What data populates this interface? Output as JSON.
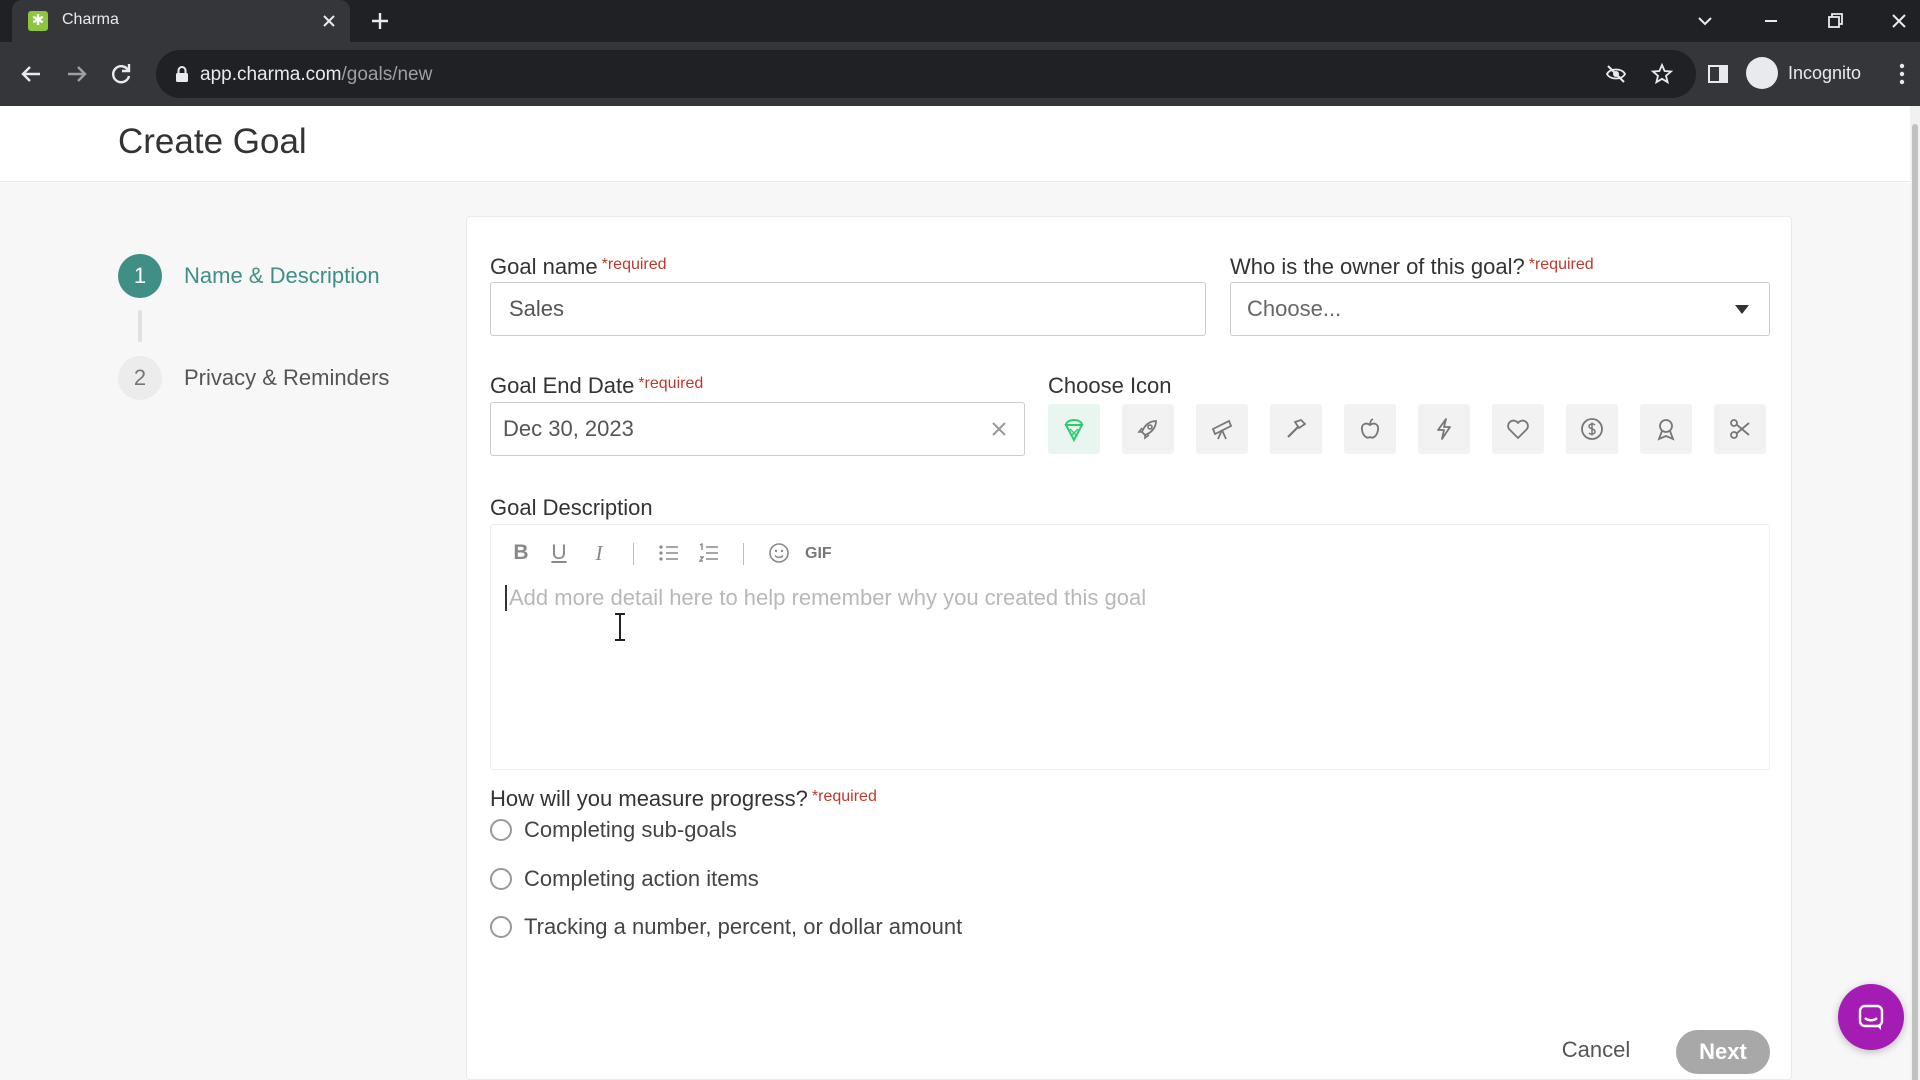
{
  "browser": {
    "tab_title": "Charma",
    "url_host": "app.charma.com",
    "url_path": "/goals/new",
    "profile_label": "Incognito"
  },
  "page": {
    "title": "Create Goal"
  },
  "stepper": [
    {
      "number": "1",
      "label": "Name & Description",
      "active": true
    },
    {
      "number": "2",
      "label": "Privacy & Reminders",
      "active": false
    }
  ],
  "form": {
    "required_marker": "*required",
    "goal_name": {
      "label": "Goal name",
      "value": "Sales"
    },
    "owner": {
      "label": "Who is the owner of this goal?",
      "value": "Choose..."
    },
    "end_date": {
      "label": "Goal End Date",
      "value": "Dec 30, 2023"
    },
    "icon_chooser": {
      "label": "Choose Icon",
      "icons": [
        "ice-cream-icon",
        "rocket-icon",
        "telescope-icon",
        "hammer-icon",
        "apple-icon",
        "lightning-icon",
        "heart-icon",
        "dollar-coin-icon",
        "medal-icon",
        "scissors-icon"
      ],
      "selected": "ice-cream-icon",
      "selected_color": "#2ecc71"
    },
    "description": {
      "label": "Goal Description",
      "gif_label": "GIF",
      "placeholder": "Add more detail here to help remember why you created this goal"
    },
    "progress": {
      "label": "How will you measure progress?",
      "options": [
        "Completing sub-goals",
        "Completing action items",
        "Tracking a number, percent, or dollar amount"
      ]
    }
  },
  "actions": {
    "cancel": "Cancel",
    "next": "Next"
  },
  "colors": {
    "accent": "#3f8f87",
    "required": "#c0392b",
    "chat": "#a51cb5"
  }
}
